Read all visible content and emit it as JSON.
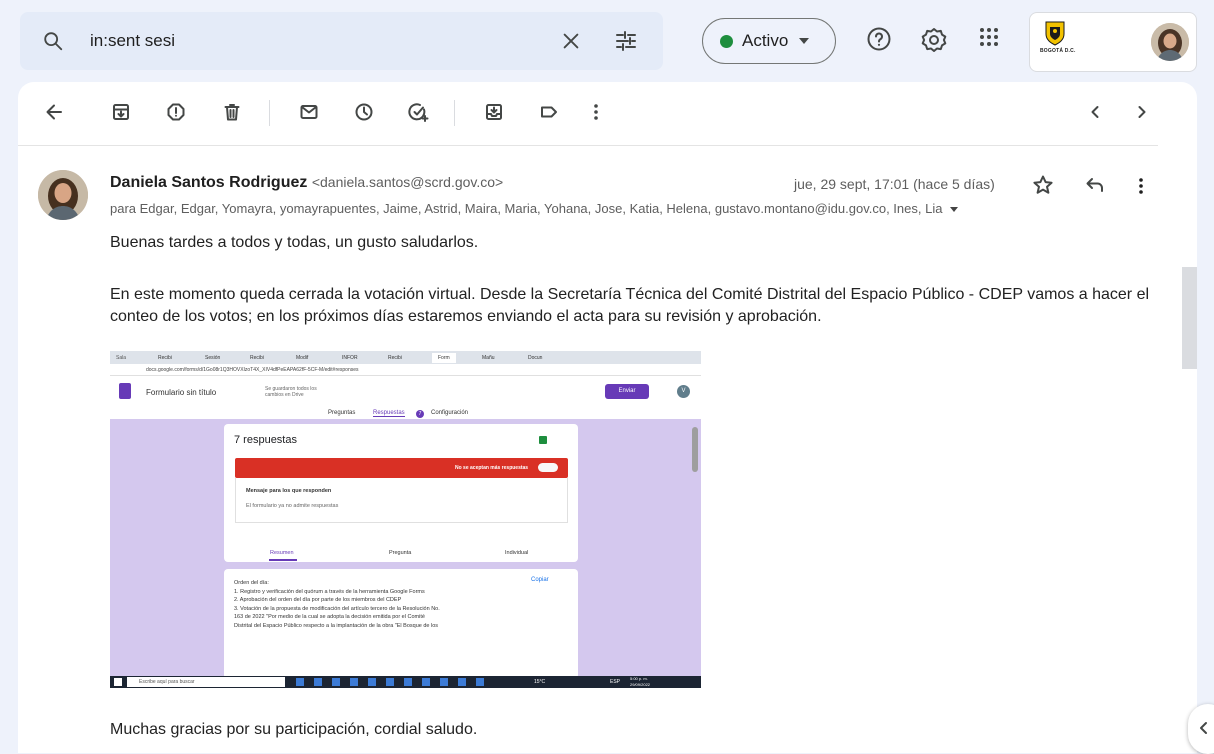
{
  "search": {
    "query": "in:sent sesi"
  },
  "status": {
    "label": "Activo",
    "color": "#1e8e3e"
  },
  "brand": {
    "seal_text": "BOGOTÁ D.C."
  },
  "email": {
    "sender_name": "Daniela Santos Rodriguez",
    "sender_email": "<daniela.santos@scrd.gov.co>",
    "date": "jue, 29 sept, 17:01 (hace 5 días)",
    "recipients": "para Edgar, Edgar, Yomayra, yomayrapuentes, Jaime, Astrid, Maira, Maria, Yohana, Jose, Katia, Helena, gustavo.montano@idu.gov.co, Ines, Lia",
    "greeting": "Buenas tardes a todos y todas, un gusto saludarlos.",
    "paragraph": "En este momento queda cerrada la votación virtual. Desde la Secretaría Técnica del Comité Distrital del Espacio Público - CDEP vamos a hacer el conteo de los votos; en los próximos días estaremos enviando el acta para su revisión y aprobación.",
    "closing": "Muchas gracias por su participación, cordial saludo."
  },
  "screenshot": {
    "tabs": [
      "Sala",
      "Recibi",
      "Sesión",
      "Recibi",
      "Modif",
      "INFOR",
      "Recibi",
      "Form",
      "Mañu",
      "Docun"
    ],
    "url": "docs.google.com/forms/d/1Go08r1Q3HOVXIzoT4X_XIV4dfPeEAPA62fF-5CF-M/edit#responses",
    "form_title": "Formulario sin título",
    "saved_note": "Se guardaron todos los cambios en Drive",
    "send_label": "Enviar",
    "avatar_letter": "V",
    "form_tabs": [
      "Preguntas",
      "Respuestas",
      "Configuración"
    ],
    "responses_badge": "7",
    "responses_title": "7 respuestas",
    "not_accepting": "No se aceptan más respuestas",
    "message_label": "Mensaje para los que responden",
    "message_value": "El formulario ya no admite respuestas",
    "view_tabs": [
      "Resumen",
      "Pregunta",
      "Individual"
    ],
    "copy_label": "Copiar",
    "agenda": [
      "Orden del día:",
      "1. Registro y verificación del quórum a través de la herramienta Google Forms",
      "2. Aprobación del orden del día por parte de los miembros del CDEP",
      "3. Votación de la propuesta de modificación del artículo tercero de la Resolución No.",
      "163 de 2022 \"Por medio de la cual se adopta la decisión emitida por el Comité",
      "Distrital del Espacio Público respecto a la implantación de la obra \"El Bosque de los"
    ],
    "taskbar_search": "Escribe aquí para buscar",
    "weather": "15°C",
    "lang": "ESP",
    "time": "5:00 p. m.",
    "date": "29/09/2022"
  }
}
